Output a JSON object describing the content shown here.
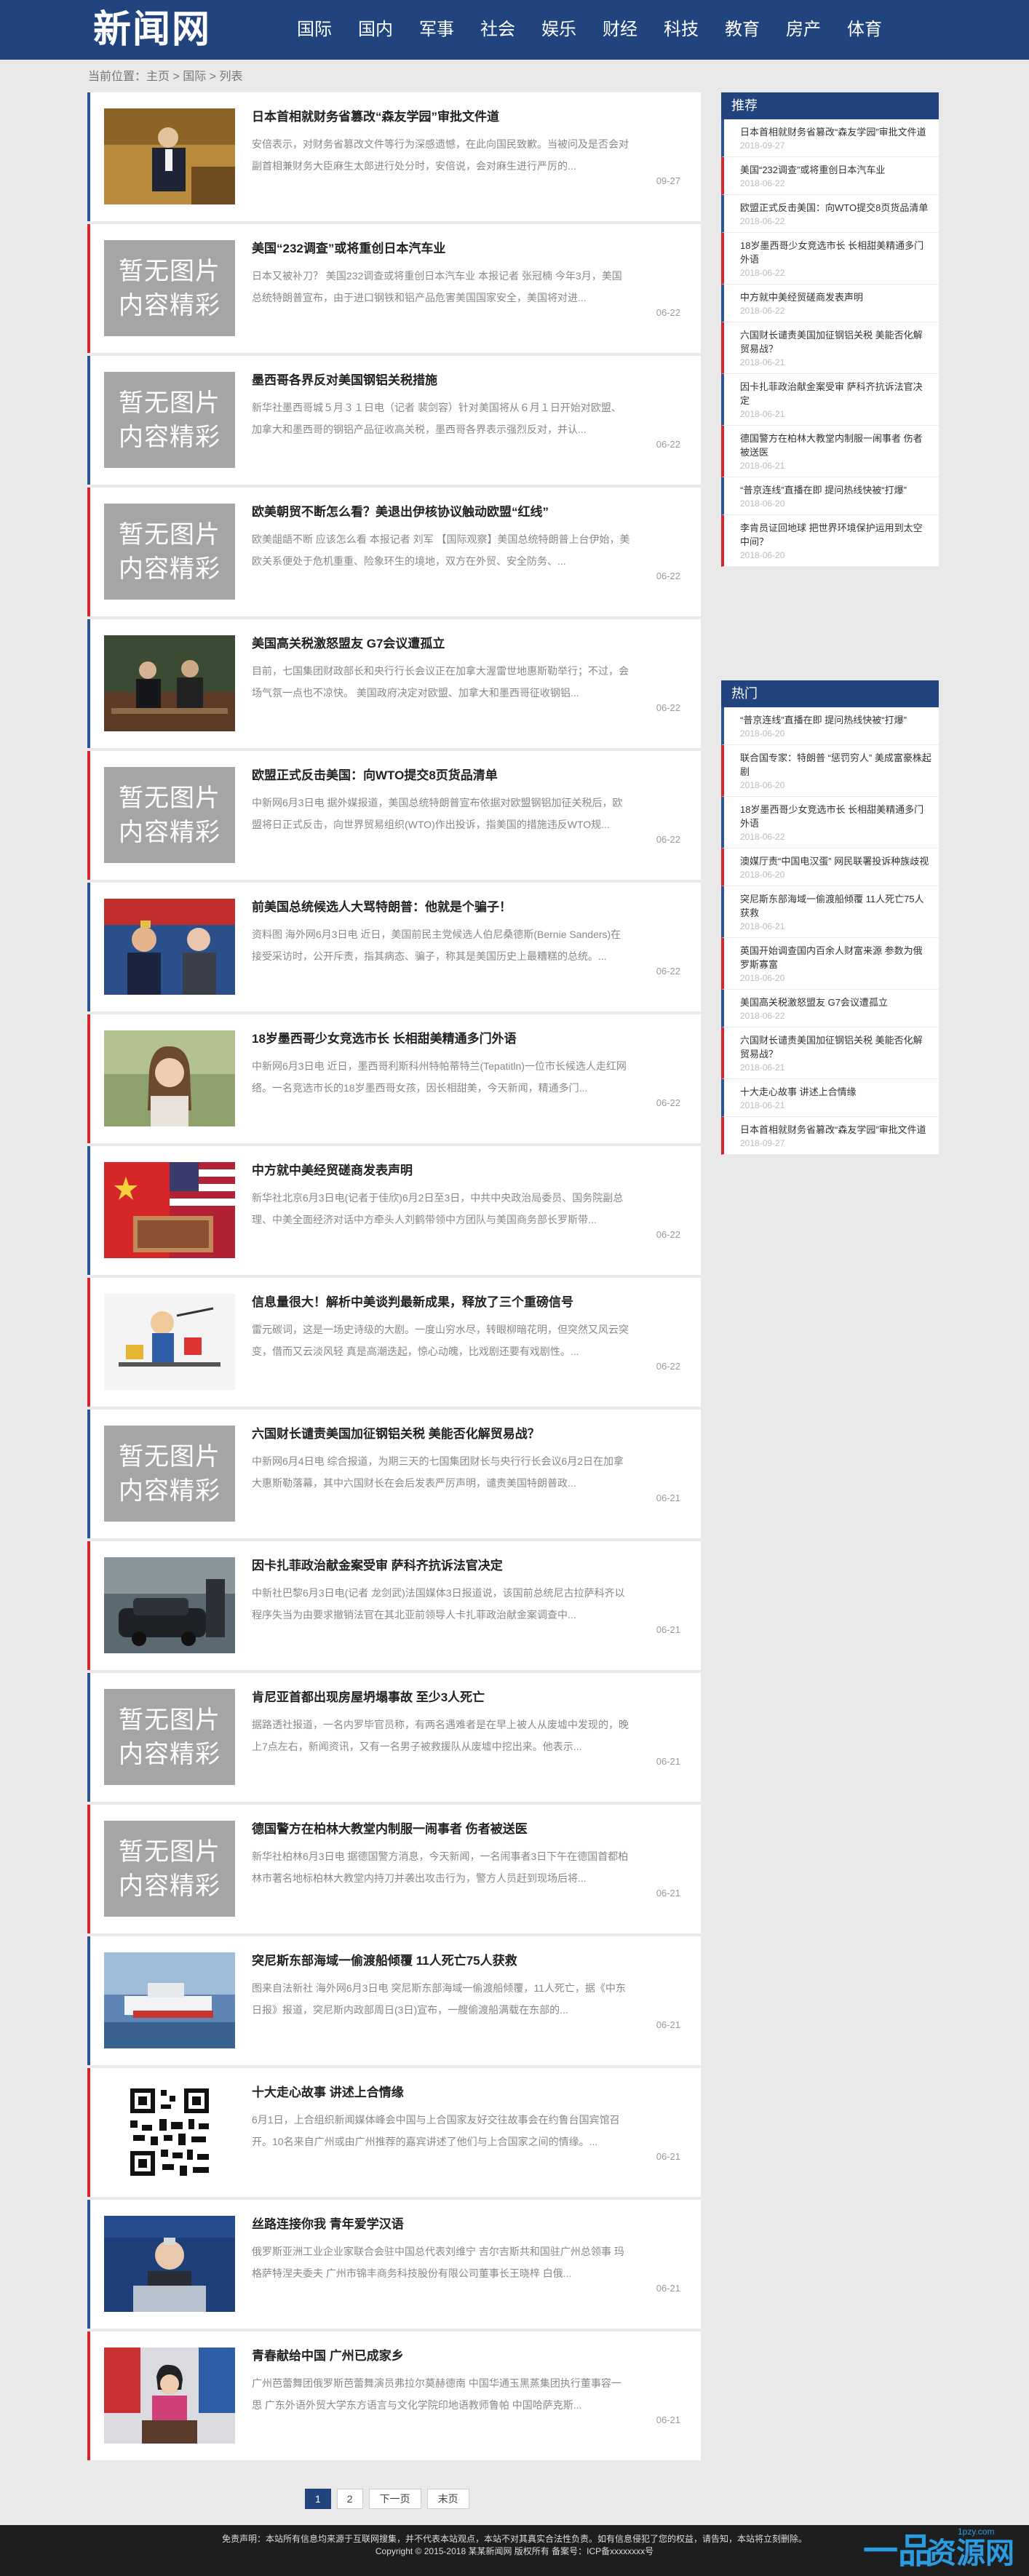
{
  "header": {
    "logo": "新闻网",
    "nav": [
      "国际",
      "国内",
      "军事",
      "社会",
      "娱乐",
      "财经",
      "科技",
      "教育",
      "房产",
      "体育"
    ]
  },
  "breadcrumb": "当前位置：主页 > 国际 > 列表",
  "no_image_text": [
    "暂无图片",
    "内容精彩"
  ],
  "articles": [
    {
      "title": "日本首相就财务省篡改“森友学园”审批文件道",
      "summary": "安倍表示，对财务省篡改文件等行为深感遗憾，在此向国民致歉。当被问及是否会对副首相兼财务大臣麻生太郎进行处分时，安倍说，会对麻生进行严厉的...",
      "date": "09-27",
      "image": "photo-podium",
      "accent": "blue"
    },
    {
      "title": "美国“232调查”或将重创日本汽车业",
      "summary": "日本又被补刀？ 美国232调查或将重创日本汽车业 本报记者 张冠楠 今年3月，美国总统特朗普宣布，由于进口钢铁和铝产品危害美国国家安全，美国将对进...",
      "date": "06-22",
      "image": "none",
      "accent": "red"
    },
    {
      "title": "墨西哥各界反对美国钢铝关税措施",
      "summary": "新华社墨西哥城５月３１日电（记者 裴剑容）针对美国将从６月１日开始对欧盟、加拿大和墨西哥的钢铝产品征收高关税，墨西哥各界表示强烈反对，并认...",
      "date": "06-22",
      "image": "none",
      "accent": "blue"
    },
    {
      "title": "欧美朝贸不断怎么看？美退出伊核协议触动欧盟“红线”",
      "summary": "欧美龃龉不断 应该怎么看 本报记者 刘军 【国际观察】美国总统特朗普上台伊始，美欧关系便处于危机重重、险象环生的境地，双方在外贸、安全防务、...",
      "date": "06-22",
      "image": "none",
      "accent": "red"
    },
    {
      "title": "美国高关税激怒盟友 G7会议遭孤立",
      "summary": "目前，七国集团财政部长和央行行长会议正在加拿大渥雷世地惠斯勒举行；不过，会场气氛一点也不凉快。 美国政府决定对欧盟、加拿大和墨西哥征收钢铝...",
      "date": "06-22",
      "image": "photo-meeting",
      "accent": "blue"
    },
    {
      "title": "欧盟正式反击美国：向WTO提交8页货品清单",
      "summary": "中新网6月3日电 据外媒报道，美国总统特朗普宣布依据对欧盟钢铝加征关税后，欧盟将日正式反击，向世界贸易组织(WTO)作出投诉，指美国的措施违反WTO规...",
      "date": "06-22",
      "image": "none",
      "accent": "red"
    },
    {
      "title": "前美国总统候选人大骂特朗普：他就是个骗子！",
      "summary": "资料图 海外网6月3日电 近日，美国前民主党候选人伯尼桑德斯(Bernie Sanders)在接受采访时，公开斥责，指其病态、骗子，称其是美国历史上最糟糕的总统。...",
      "date": "06-22",
      "image": "photo-politicians",
      "accent": "blue"
    },
    {
      "title": "18岁墨西哥少女竞选市长 长相甜美精通多门外语",
      "summary": "中新网6月3日电 近日，墨西哥利斯科州特帕蒂特兰(Tepatitln)一位市长候选人走红网络。一名竞选市长的18岁墨西哥女孩，因长相甜美，今天新闻，精通多门...",
      "date": "06-22",
      "image": "photo-girl",
      "accent": "red"
    },
    {
      "title": "中方就中美经贸磋商发表声明",
      "summary": "新华社北京6月3日电(记者于佳欣)6月2日至3日，中共中央政治局委员、国务院副总理、中美全面经济对话中方牵头人刘鹤带领中方团队与美国商务部长罗斯带...",
      "date": "06-22",
      "image": "photo-flags",
      "accent": "blue"
    },
    {
      "title": "信息量很大！解析中美谈判最新成果，释放了三个重磅信号",
      "summary": "雷元碳词，这是一场史诗级的大剧。一度山穷水尽，转眼柳暗花明，但突然又风云突变，借而又云淡风轻 真是高潮迭起，惊心动魄，比戏剧还要有戏剧性。...",
      "date": "06-22",
      "image": "photo-cartoon",
      "accent": "red"
    },
    {
      "title": "六国财长谴责美国加征钢铝关税 美能否化解贸易战？",
      "summary": "中新网6月4日电 综合报道，为期三天的七国集团财长与央行行长会议6月2日在加拿大惠斯勒落幕，其中六国财长在会后发表严厉声明，谴责美国特朗普政...",
      "date": "06-21",
      "image": "none",
      "accent": "blue"
    },
    {
      "title": "因卡扎菲政治献金案受审 萨科齐抗诉法官决定",
      "summary": "中新社巴黎6月3日电(记者 龙剑武)法国媒体3日报道说，该国前总统尼古拉萨科齐以程序失当为由要求撤销法官在其北亚前领导人卡扎菲政治献金案调查中...",
      "date": "06-21",
      "image": "photo-car",
      "accent": "red"
    },
    {
      "title": "肯尼亚首都出现房屋坍塌事故 至少3人死亡",
      "summary": "据路透社报道，一名内罗毕官员称，有两名遇难者是在早上被人从废墟中发现的，晚上7点左右，新闻资讯，又有一名男子被救援队从废墟中挖出来。他表示...",
      "date": "06-21",
      "image": "none",
      "accent": "blue"
    },
    {
      "title": "德国警方在柏林大教堂内制服一闹事者 伤者被送医",
      "summary": "新华社柏林6月3日电 据德国警方消息，今天新闻，一名闹事者3日下午在德国首都柏林市著名地标柏林大教堂内持刀并袭出攻击行为，警方人员赶到现场后将...",
      "date": "06-21",
      "image": "none",
      "accent": "red"
    },
    {
      "title": "突尼斯东部海域一偷渡船倾覆 11人死亡75人获救",
      "summary": "图来自法新社 海外网6月3日电 突尼斯东部海域一偷渡船倾覆，11人死亡，据《中东日报》报道，突尼斯内政部周日(3日)宣布，一艘偷渡船满载在东部的...",
      "date": "06-21",
      "image": "photo-boat",
      "accent": "blue"
    },
    {
      "title": "十大走心故事 讲述上合情缘",
      "summary": "6月1日，上合组织新闻媒体峰会中国与上合国家友好交往故事会在约鲁台国宾馆召开。10名来自广州或由广州推荐的嘉宾讲述了他们与上合国家之间的情缘。...",
      "date": "06-21",
      "image": "qr",
      "accent": "red"
    },
    {
      "title": "丝路连接你我 青年爱学汉语",
      "summary": "俄罗斯亚洲工业企业家联合会驻中国总代表刘维宁 吉尔吉斯共和国驻广州总领事 玛格萨特涅夫委夫 广州市锦丰商务科技股份有限公司董事长王晓梓 白俄...",
      "date": "06-21",
      "image": "photo-speaker",
      "accent": "blue"
    },
    {
      "title": "青春献给中国 广州已成家乡",
      "summary": "广州芭蕾舞团俄罗斯芭蕾舞演员弗拉尔莫赫德南 中国华通玉黑蒸集团执行董事容一思 广东外语外贸大学东方语言与文化学院印地语教师鲁帕 中国哈萨克斯...",
      "date": "06-21",
      "image": "photo-woman-flags",
      "accent": "red"
    }
  ],
  "pagination": [
    "1",
    "2",
    "下一页",
    "末页"
  ],
  "sidebar_recommend": {
    "title": "推荐",
    "items": [
      {
        "title": "日本首相就财务省篡改“森友学园”审批文件道",
        "date": "2018-09-27",
        "accent": "blue"
      },
      {
        "title": "美国“232调查”或将重创日本汽车业",
        "date": "2018-06-22",
        "accent": "red"
      },
      {
        "title": "欧盟正式反击美国：向WTO提交8页货品清单",
        "date": "2018-06-22",
        "accent": "blue"
      },
      {
        "title": "18岁墨西哥少女竞选市长 长相甜美精通多门外语",
        "date": "2018-06-22",
        "accent": "red"
      },
      {
        "title": "中方就中美经贸磋商发表声明",
        "date": "2018-06-22",
        "accent": "blue"
      },
      {
        "title": "六国财长谴责美国加征钢铝关税 美能否化解贸易战？",
        "date": "2018-06-21",
        "accent": "red"
      },
      {
        "title": "因卡扎菲政治献金案受审 萨科齐抗诉法官决定",
        "date": "2018-06-21",
        "accent": "blue"
      },
      {
        "title": "德国警方在柏林大教堂内制服一闹事者 伤者被送医",
        "date": "2018-06-21",
        "accent": "red"
      },
      {
        "title": "“普京连线”直播在即 提问热线快被“打爆”",
        "date": "2018-06-20",
        "accent": "blue"
      },
      {
        "title": "李肯员证回地球 把世界环境保护运用到太空中间？",
        "date": "2018-06-20",
        "accent": "red"
      }
    ]
  },
  "sidebar_hot": {
    "title": "热门",
    "items": [
      {
        "title": "“普京连线”直播在即 提问热线快被“打爆”",
        "date": "2018-06-20",
        "accent": "blue"
      },
      {
        "title": "联合国专家：特朗普 “惩罚穷人” 美成富豪株起剧",
        "date": "2018-06-20",
        "accent": "red"
      },
      {
        "title": "18岁墨西哥少女竞选市长 长相甜美精通多门外语",
        "date": "2018-06-22",
        "accent": "blue"
      },
      {
        "title": "澳媒厅责“中国电汉蛋” 网民联署投诉种族歧视",
        "date": "2018-06-20",
        "accent": "red"
      },
      {
        "title": "突尼斯东部海域一偷渡船倾覆 11人死亡75人获救",
        "date": "2018-06-21",
        "accent": "blue"
      },
      {
        "title": "英国开始调查国内百余人财富来源 参数为俄罗斯寡富",
        "date": "2018-06-20",
        "accent": "red"
      },
      {
        "title": "美国高关税激怒盟友 G7会议遭孤立",
        "date": "2018-06-22",
        "accent": "blue"
      },
      {
        "title": "六国财长谴责美国加征钢铝关税 美能否化解贸易战？",
        "date": "2018-06-21",
        "accent": "red"
      },
      {
        "title": "十大走心故事 讲述上合情缘",
        "date": "2018-06-21",
        "accent": "blue"
      },
      {
        "title": "日本首相就财务省篡改“森友学园”审批文件道",
        "date": "2018-09-27",
        "accent": "red"
      }
    ]
  },
  "footer": {
    "line1": "免责声明：本站所有信息均来源于互联网搜集，并不代表本站观点，本站不对其真实合法性负责。如有信息侵犯了您的权益，请告知，本站将立刻删除。",
    "line2": "Copyright © 2015-2018 某某新闻网 版权所有 备案号：ICP备xxxxxxxx号"
  },
  "brand": {
    "mark": "一品",
    "name": "资源网",
    "url": "1pzy.com"
  },
  "colors": {
    "primary": "#21447f",
    "accent_blue": "#2b5495",
    "accent_red": "#d9242e"
  }
}
